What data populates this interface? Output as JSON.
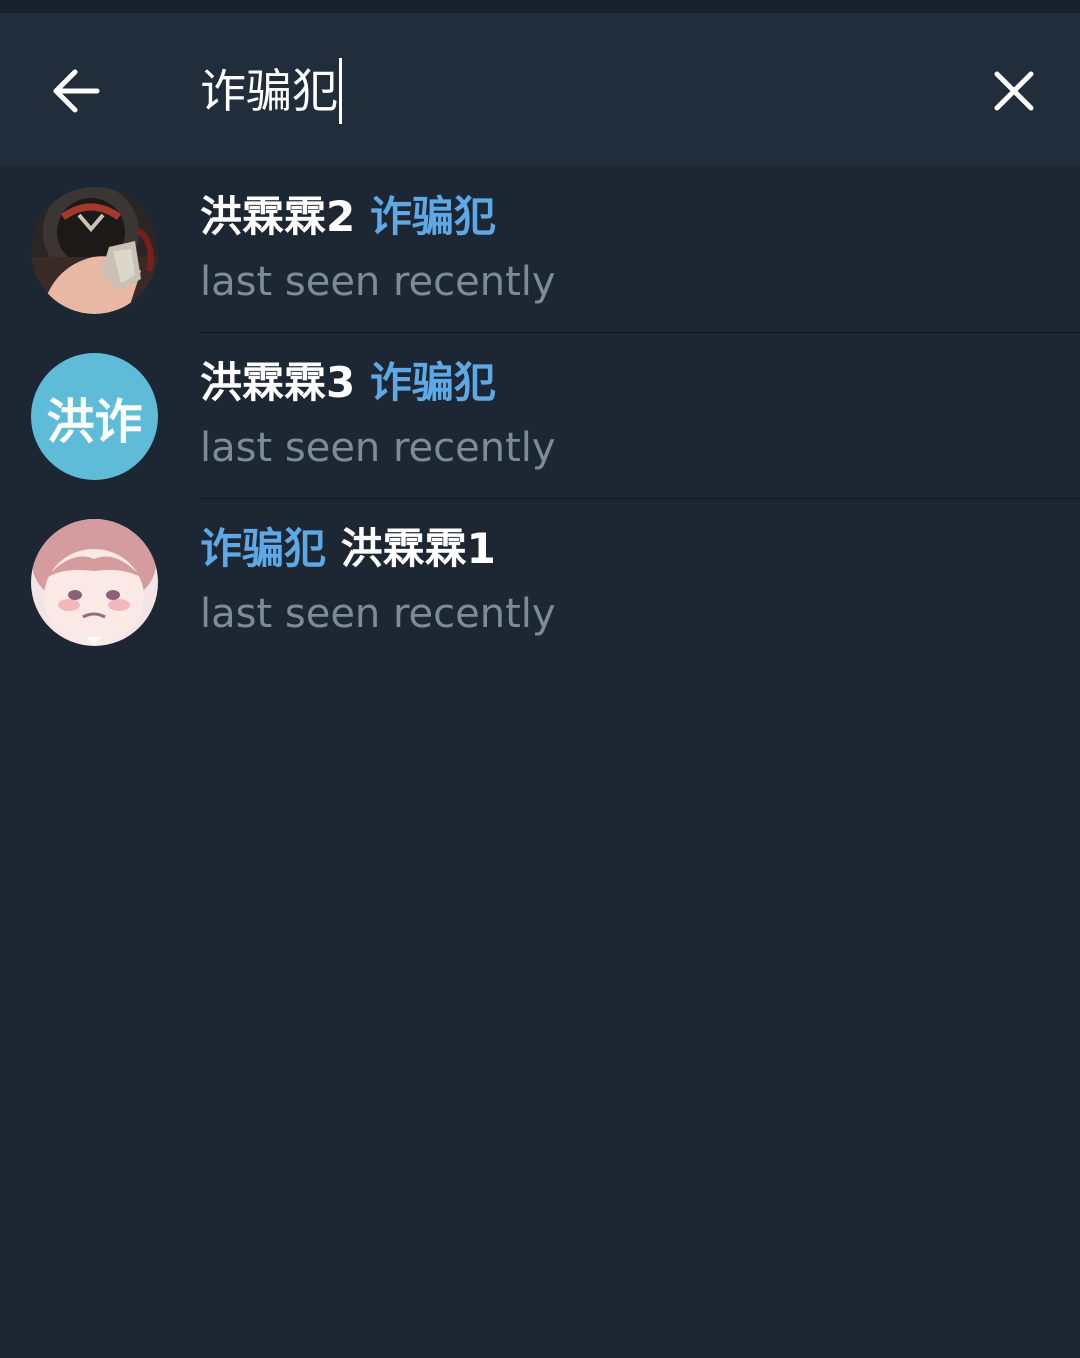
{
  "search": {
    "value": "诈骗犯",
    "back_icon": "arrow-left-icon",
    "clear_icon": "close-icon"
  },
  "colors": {
    "background": "#1d2733",
    "header": "#212d3b",
    "highlight": "#5ea8e6",
    "secondary_text": "#7d8b99",
    "avatar_placeholder": "#5fbcd8"
  },
  "results": [
    {
      "name_part_1": "洪霖霖2",
      "name_part_2": "诈骗犯",
      "highlight_part": 2,
      "status": "last seen recently",
      "avatar_type": "photo"
    },
    {
      "name_part_1": "洪霖霖3",
      "name_part_2": "诈骗犯",
      "highlight_part": 2,
      "status": "last seen recently",
      "avatar_type": "initials",
      "avatar_initials": "洪诈"
    },
    {
      "name_part_1": "诈骗犯",
      "name_part_2": "洪霖霖1",
      "highlight_part": 1,
      "status": "last seen recently",
      "avatar_type": "photo"
    }
  ]
}
